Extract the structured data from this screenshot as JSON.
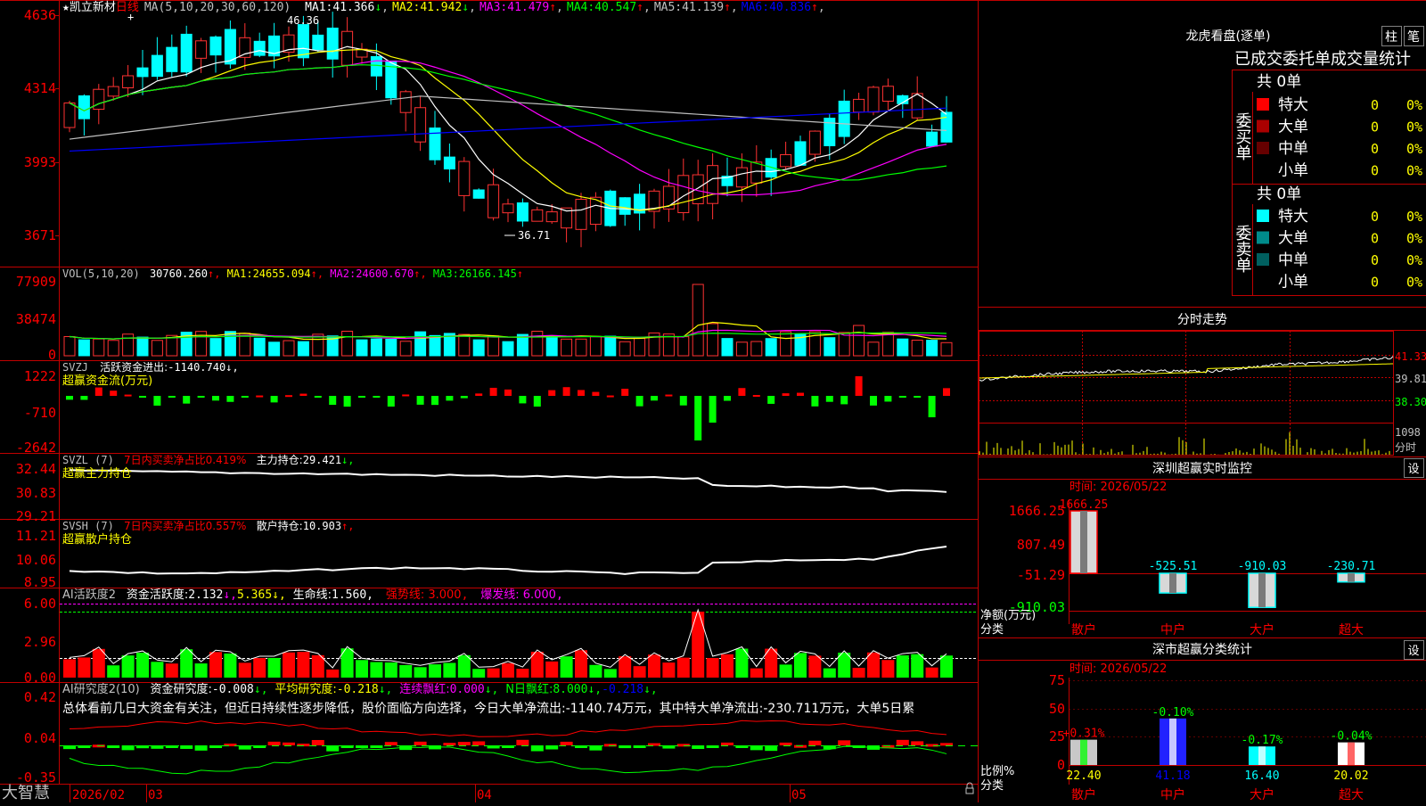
{
  "main_chart": {
    "stock_name": "凯立新材",
    "period": "日线",
    "ma_params": "MA(5,10,20,30,60,120)",
    "ma_values": [
      {
        "label": "MA1:",
        "value": "41.366",
        "arrow": "↓",
        "color": "#ffffff"
      },
      {
        "label": "MA2:",
        "value": "41.942",
        "arrow": "↓",
        "color": "#ffff00"
      },
      {
        "label": "MA3:",
        "value": "41.479",
        "arrow": "↑",
        "color": "#ff00ff"
      },
      {
        "label": "MA4:",
        "value": "40.547",
        "arrow": "↑",
        "color": "#00ff00"
      },
      {
        "label": "MA5:",
        "value": "41.139",
        "arrow": "↑",
        "color": "#c0c0c0"
      },
      {
        "label": "MA6:",
        "value": "40.836",
        "arrow": "↑",
        "color": "#0000ff"
      }
    ],
    "y_ticks": [
      "4636",
      "4314",
      "3993",
      "3671"
    ],
    "high_label": "46.36",
    "low_label": "36.71"
  },
  "vol_panel": {
    "header": "VOL(5,10,20)",
    "value": "30760.260",
    "ma1_label": "MA1:",
    "ma1": "24655.094",
    "ma2_label": "MA2:",
    "ma2": "24600.670",
    "ma3_label": "MA3:",
    "ma3": "26166.145",
    "y_ticks": [
      "77909",
      "38474",
      "0"
    ]
  },
  "svzj_panel": {
    "header": "SVZJ",
    "label": "活跃资金进出:",
    "value": "-1140.740",
    "subtitle": "超赢资金流(万元)",
    "y_ticks": [
      "1222",
      "-710",
      "-2642"
    ]
  },
  "svzl_panel": {
    "header": "SVZL (7)",
    "ratio": "7日内买卖净占比0.419%",
    "label": "主力持仓:",
    "value": "29.421",
    "subtitle": "超赢主力持仓",
    "y_ticks": [
      "32.44",
      "30.83",
      "29.21"
    ]
  },
  "svsh_panel": {
    "header": "SVSH (7)",
    "ratio": "7日内买卖净占比0.557%",
    "label": "散户持仓:",
    "value": "10.903",
    "subtitle": "超赢散户持仓",
    "y_ticks": [
      "11.21",
      "10.06",
      "8.95"
    ]
  },
  "ai_active": {
    "header": "AI活跃度2",
    "label": "资金活跃度:",
    "v1": "2.132",
    "v2": "5.365",
    "life_label": "生命线:",
    "life": "1.560",
    "strong": "强势线: 3.000",
    "burst": "爆发线: 6.000",
    "y_ticks": [
      "6.00",
      "2.96",
      "0.00"
    ]
  },
  "ai_research": {
    "header": "AI研究度2(10)",
    "label1": "资金研究度:",
    "v1": "-0.008",
    "label2": "平均研究度:",
    "v2": "-0.218",
    "label3": "连续飘红:",
    "v3": "0.000",
    "label4": "N日飘红:",
    "v4": "8.000",
    "v5": "-0.218",
    "comment": "总体看前几日大资金有关注，但近日持续性逐步降低，股价面临方向选择，今日大单净流出:-1140.74万元，其中特大单净流出:-230.711万元，大单5日累",
    "y_ticks": [
      "0.42",
      "0.04",
      "-0.35"
    ]
  },
  "bottom_axis": {
    "logo": "大智慧",
    "dates": [
      "2026/02",
      "03",
      "04",
      "05"
    ]
  },
  "dragon_tiger": {
    "title": "龙虎看盘(逐单)",
    "btn_bar": "柱",
    "btn_pen": "笔",
    "tabs": "已成交委托单成交量统计",
    "buy_label": "委买单",
    "sell_label": "委卖单",
    "buy_total": "共 0单",
    "sell_total": "共 0单",
    "buy_rows": [
      {
        "name": "特大",
        "count": "0",
        "pct": "0%",
        "color": "#ff0000"
      },
      {
        "name": "大单",
        "count": "0",
        "pct": "0%",
        "color": "#aa0000"
      },
      {
        "name": "中单",
        "count": "0",
        "pct": "0%",
        "color": "#660000"
      },
      {
        "name": "小单",
        "count": "0",
        "pct": "0%",
        "color": "#000000"
      }
    ],
    "sell_rows": [
      {
        "name": "特大",
        "count": "0",
        "pct": "0%",
        "color": "#00ffff"
      },
      {
        "name": "大单",
        "count": "0",
        "pct": "0%",
        "color": "#008b8b"
      },
      {
        "name": "中单",
        "count": "0",
        "pct": "0%",
        "color": "#005f5f"
      },
      {
        "name": "小单",
        "count": "0",
        "pct": "0%",
        "color": "#000000"
      }
    ]
  },
  "intraday": {
    "title": "分时走势",
    "y_ticks": [
      "41.33",
      "39.81",
      "38.30"
    ],
    "vol_tick": "1098",
    "vol_label": "分时"
  },
  "sz_monitor": {
    "title": "深圳超赢实时监控",
    "settings": "设",
    "time": "时间: 2026/05/22",
    "y_ticks": [
      "1666.25",
      "807.49",
      "-51.29",
      "-910.03"
    ],
    "y_title": "净额(万元)",
    "x_title": "分类",
    "categories": [
      "散户",
      "中户",
      "大户",
      "超大"
    ],
    "values": [
      1666.25,
      -525.51,
      -910.03,
      -230.71
    ],
    "value_labels": [
      "1666.25",
      "-525.51",
      "-910.03",
      "-230.71"
    ]
  },
  "sz_class": {
    "title": "深市超赢分类统计",
    "settings": "设",
    "time": "时间: 2026/05/22",
    "y_ticks": [
      "75",
      "50",
      "25",
      "0"
    ],
    "y_title": "比例%",
    "x_title": "分类",
    "categories": [
      "散户",
      "中户",
      "大户",
      "超大"
    ],
    "values": [
      22.4,
      41.18,
      16.4,
      20.02
    ],
    "value_labels": [
      "22.40",
      "41.18",
      "16.40",
      "20.02"
    ],
    "changes": [
      "+0.31%",
      "-0.10%",
      "-0.17%",
      "-0.04%"
    ]
  }
}
